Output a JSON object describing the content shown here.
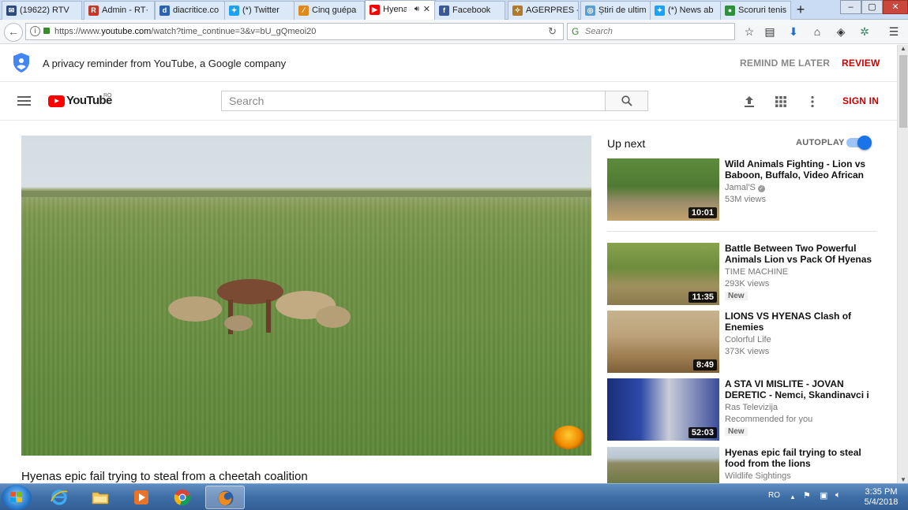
{
  "browser": {
    "tabs": [
      {
        "label": "(19622) RTV",
        "icon": "tumblr-icon",
        "color": "#2e4a7c",
        "glyph": "✉"
      },
      {
        "label": "Admin - RT·",
        "icon": "r-icon",
        "color": "#c0392b",
        "glyph": "R"
      },
      {
        "label": "diacritice.co",
        "icon": "d-icon",
        "color": "#2b63b0",
        "glyph": "d"
      },
      {
        "label": "(*) Twitter",
        "icon": "twitter-icon",
        "color": "#1da1f2",
        "glyph": "✦"
      },
      {
        "label": "Cinq guépa",
        "icon": "brush-icon",
        "color": "#e08a1e",
        "glyph": "⁄"
      },
      {
        "label": "Hyena",
        "icon": "youtube-icon",
        "color": "#ff0000",
        "glyph": "▶",
        "active": true
      },
      {
        "label": "Facebook",
        "icon": "facebook-icon",
        "color": "#3b5998",
        "glyph": "f"
      },
      {
        "label": "AGERPRES -",
        "icon": "agerpres-icon",
        "color": "#b07a2a",
        "glyph": "✧"
      },
      {
        "label": "Știri de ultim",
        "icon": "globe-icon",
        "color": "#5a9fd4",
        "glyph": "◎"
      },
      {
        "label": "(*) News ab",
        "icon": "twitter-icon",
        "color": "#1da1f2",
        "glyph": "✦"
      },
      {
        "label": "Scoruri tenis",
        "icon": "score-icon",
        "color": "#2f8f3a",
        "glyph": "●"
      }
    ],
    "url_prefix": "https://www.",
    "url_host": "youtube.com",
    "url_rest": "/watch?time_continue=3&v=bU_gQmeoi20",
    "search_placeholder": "Search"
  },
  "privacy": {
    "message": "A privacy reminder from YouTube, a Google company",
    "remind_label": "REMIND ME LATER",
    "review_label": "REVIEW"
  },
  "masthead": {
    "logo_text": "YouTube",
    "region": "RO",
    "search_placeholder": "Search",
    "signin_label": "SIGN IN"
  },
  "video": {
    "title": "Hyenas epic fail trying to steal from a cheetah coalition"
  },
  "sidebar": {
    "upnext_label": "Up next",
    "autoplay_label": "AUTOPLAY",
    "autoplay_on": true,
    "items": [
      {
        "title": "Wild Animals Fighting - Lion vs Baboon, Buffalo, Video African",
        "channel": "Jamal'S",
        "verified": true,
        "views": "53M views",
        "duration": "10:01",
        "extra": "",
        "badge": ""
      },
      {
        "title": "Battle Between Two Powerful Animals Lion vs Pack Of Hyenas",
        "channel": "TIME MACHINE",
        "verified": false,
        "views": "293K views",
        "duration": "11:35",
        "extra": "",
        "badge": "New"
      },
      {
        "title": "LIONS VS HYENAS Clash of Enemies",
        "channel": "Colorful Life",
        "verified": false,
        "views": "373K views",
        "duration": "8:49",
        "extra": "",
        "badge": ""
      },
      {
        "title": "A STA VI MISLITE - JOVAN DERETIC - Nemci, Skandinavci i",
        "channel": "Ras Televizija",
        "verified": false,
        "views": "Recommended for you",
        "duration": "52:03",
        "extra": "",
        "badge": "New"
      },
      {
        "title": "Hyenas epic fail trying to steal food from the lions",
        "channel": "Wildlife Sightings",
        "verified": false,
        "views": "",
        "duration": "",
        "extra": "",
        "badge": ""
      }
    ]
  },
  "taskbar": {
    "lang": "RO",
    "time": "3:35 PM",
    "date": "5/4/2018"
  }
}
